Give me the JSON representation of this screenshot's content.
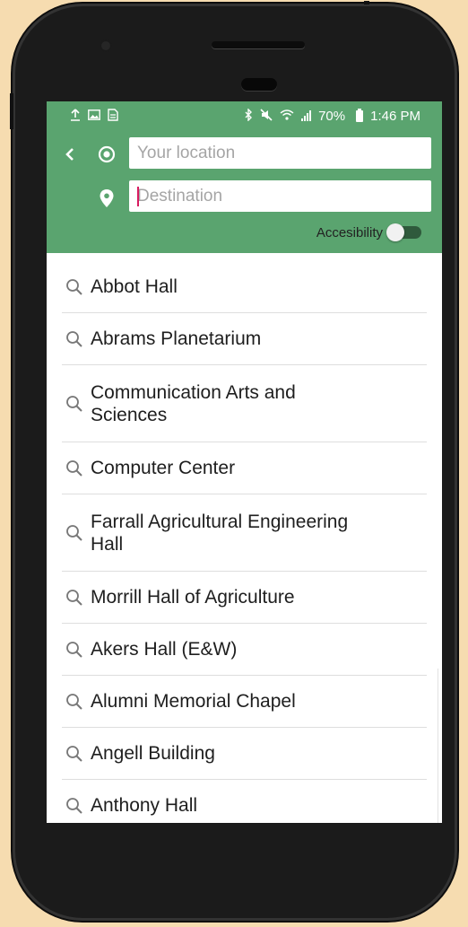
{
  "status_bar": {
    "time": "1:46 PM",
    "battery": "70%"
  },
  "search": {
    "origin_placeholder": "Your location",
    "destination_placeholder": "Destination"
  },
  "accessibility": {
    "label": "Accesibility",
    "enabled": false
  },
  "results": [
    {
      "name": "Abbot Hall"
    },
    {
      "name": "Abrams Planetarium"
    },
    {
      "name": "Communication Arts and Sciences"
    },
    {
      "name": "Computer Center"
    },
    {
      "name": "Farrall Agricultural Engineering Hall"
    },
    {
      "name": "Morrill Hall of Agriculture"
    },
    {
      "name": "Akers Hall (E&W)"
    },
    {
      "name": "Alumni Memorial Chapel"
    },
    {
      "name": "Angell Building"
    },
    {
      "name": "Anthony Hall"
    }
  ],
  "colors": {
    "header": "#5aa46f",
    "toggle_track": "#2f5a3c",
    "caret": "#d81b60"
  }
}
